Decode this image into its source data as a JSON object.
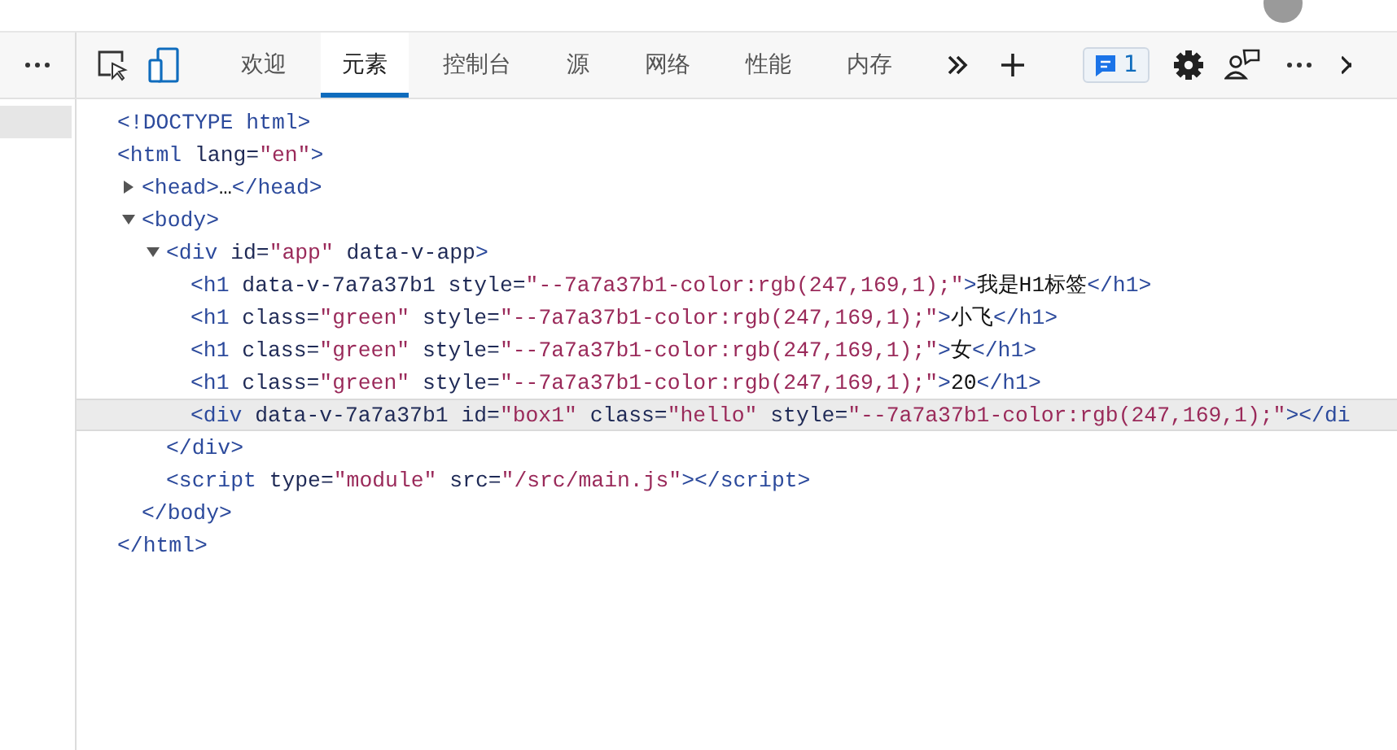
{
  "toolbar": {
    "tabs": [
      {
        "label": "欢迎",
        "selected": false
      },
      {
        "label": "元素",
        "selected": true
      },
      {
        "label": "控制台",
        "selected": false
      },
      {
        "label": "源",
        "selected": false
      },
      {
        "label": "网络",
        "selected": false
      },
      {
        "label": "性能",
        "selected": false
      },
      {
        "label": "内存",
        "selected": false
      }
    ],
    "issues_badge": "1"
  },
  "dom_tree": [
    {
      "kind": "leaf",
      "selected": false,
      "tokens": [
        {
          "kind": "tag",
          "text": "<!DOCTYPE html>"
        }
      ]
    },
    {
      "kind": "open",
      "selected": false,
      "tokens": [
        {
          "kind": "tag",
          "text": "<html"
        },
        {
          "kind": "attr",
          "text": " lang="
        },
        {
          "kind": "value",
          "text": "\"en\""
        },
        {
          "kind": "tag",
          "text": ">"
        }
      ],
      "closing": "</html>",
      "children": [
        {
          "kind": "toggle",
          "expanded": false,
          "selected": false,
          "tokens": [
            {
              "kind": "tag",
              "text": "<head>"
            },
            {
              "kind": "text",
              "text": "…"
            },
            {
              "kind": "tag",
              "text": "</head>"
            }
          ]
        },
        {
          "kind": "toggle",
          "expanded": true,
          "selected": false,
          "tokens": [
            {
              "kind": "tag",
              "text": "<body>"
            }
          ],
          "closing": "</body>",
          "children": [
            {
              "kind": "toggle",
              "expanded": true,
              "selected": false,
              "tokens": [
                {
                  "kind": "tag",
                  "text": "<div"
                },
                {
                  "kind": "attr",
                  "text": " id="
                },
                {
                  "kind": "value",
                  "text": "\"app\""
                },
                {
                  "kind": "attr",
                  "text": " data-v-app"
                },
                {
                  "kind": "tag",
                  "text": ">"
                }
              ],
              "closing": "</div>",
              "children": [
                {
                  "kind": "leaf",
                  "selected": false,
                  "tokens": [
                    {
                      "kind": "tag",
                      "text": "<h1"
                    },
                    {
                      "kind": "attr",
                      "text": " data-v-7a7a37b1 style="
                    },
                    {
                      "kind": "value",
                      "text": "\"--7a7a37b1-color:rgb(247,169,1);\""
                    },
                    {
                      "kind": "tag",
                      "text": ">"
                    },
                    {
                      "kind": "text",
                      "text": "我是H1标签"
                    },
                    {
                      "kind": "tag",
                      "text": "</h1>"
                    }
                  ]
                },
                {
                  "kind": "leaf",
                  "selected": false,
                  "tokens": [
                    {
                      "kind": "tag",
                      "text": "<h1"
                    },
                    {
                      "kind": "attr",
                      "text": " class="
                    },
                    {
                      "kind": "value",
                      "text": "\"green\""
                    },
                    {
                      "kind": "attr",
                      "text": " style="
                    },
                    {
                      "kind": "value",
                      "text": "\"--7a7a37b1-color:rgb(247,169,1);\""
                    },
                    {
                      "kind": "tag",
                      "text": ">"
                    },
                    {
                      "kind": "text",
                      "text": "小飞"
                    },
                    {
                      "kind": "tag",
                      "text": "</h1>"
                    }
                  ]
                },
                {
                  "kind": "leaf",
                  "selected": false,
                  "tokens": [
                    {
                      "kind": "tag",
                      "text": "<h1"
                    },
                    {
                      "kind": "attr",
                      "text": " class="
                    },
                    {
                      "kind": "value",
                      "text": "\"green\""
                    },
                    {
                      "kind": "attr",
                      "text": " style="
                    },
                    {
                      "kind": "value",
                      "text": "\"--7a7a37b1-color:rgb(247,169,1);\""
                    },
                    {
                      "kind": "tag",
                      "text": ">"
                    },
                    {
                      "kind": "text",
                      "text": "女"
                    },
                    {
                      "kind": "tag",
                      "text": "</h1>"
                    }
                  ]
                },
                {
                  "kind": "leaf",
                  "selected": false,
                  "tokens": [
                    {
                      "kind": "tag",
                      "text": "<h1"
                    },
                    {
                      "kind": "attr",
                      "text": " class="
                    },
                    {
                      "kind": "value",
                      "text": "\"green\""
                    },
                    {
                      "kind": "attr",
                      "text": " style="
                    },
                    {
                      "kind": "value",
                      "text": "\"--7a7a37b1-color:rgb(247,169,1);\""
                    },
                    {
                      "kind": "tag",
                      "text": ">"
                    },
                    {
                      "kind": "text",
                      "text": "20"
                    },
                    {
                      "kind": "tag",
                      "text": "</h1>"
                    }
                  ]
                },
                {
                  "kind": "leaf",
                  "selected": true,
                  "tokens": [
                    {
                      "kind": "tag",
                      "text": "<div"
                    },
                    {
                      "kind": "attr",
                      "text": " data-v-7a7a37b1 id="
                    },
                    {
                      "kind": "value",
                      "text": "\"box1\""
                    },
                    {
                      "kind": "attr",
                      "text": " class="
                    },
                    {
                      "kind": "value",
                      "text": "\"hello\""
                    },
                    {
                      "kind": "attr",
                      "text": " style="
                    },
                    {
                      "kind": "value",
                      "text": "\"--7a7a37b1-color:rgb(247,169,1);\""
                    },
                    {
                      "kind": "tag",
                      "text": "></di"
                    }
                  ]
                }
              ]
            },
            {
              "kind": "leaf",
              "selected": false,
              "tokens": [
                {
                  "kind": "tag",
                  "text": "<script"
                },
                {
                  "kind": "attr",
                  "text": " type="
                },
                {
                  "kind": "value",
                  "text": "\"module\""
                },
                {
                  "kind": "attr",
                  "text": " src="
                },
                {
                  "kind": "value",
                  "text": "\"/src/main.js\""
                },
                {
                  "kind": "tag",
                  "text": "></script>"
                }
              ]
            }
          ]
        }
      ]
    }
  ]
}
